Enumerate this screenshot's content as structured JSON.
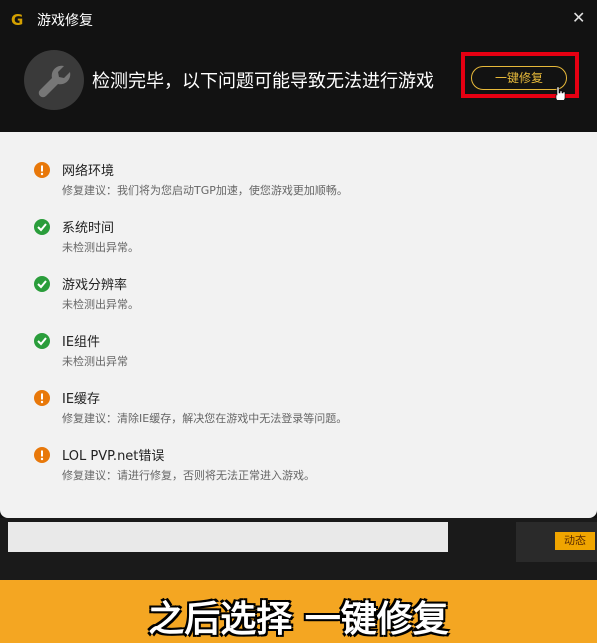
{
  "window": {
    "title": "游戏修复",
    "close_glyph": "✕"
  },
  "header": {
    "headline": "检测完毕，以下问题可能导致无法进行游戏",
    "fix_button_label": "一键修复"
  },
  "items": [
    {
      "status": "warn",
      "title": "网络环境",
      "desc": "修复建议：我们将为您启动TGP加速，使您游戏更加顺畅。"
    },
    {
      "status": "ok",
      "title": "系统时间",
      "desc": "未检测出异常。"
    },
    {
      "status": "ok",
      "title": "游戏分辨率",
      "desc": "未检测出异常。"
    },
    {
      "status": "ok",
      "title": "IE组件",
      "desc": "未检测出异常"
    },
    {
      "status": "warn",
      "title": "IE缓存",
      "desc": "修复建议：清除IE缓存，解决您在游戏中无法登录等问题。"
    },
    {
      "status": "warn",
      "title": "LOL PVP.net错误",
      "desc": "修复建议：请进行修复，否则将无法正常进入游戏。"
    }
  ],
  "background": {
    "badge_label": "动态"
  },
  "caption": "之后选择 一键修复",
  "colors": {
    "accent": "#e7b93a",
    "highlight": "#e60012",
    "warn": "#e8780a",
    "ok": "#2a9d3b",
    "caption_bar": "#f4a622"
  }
}
